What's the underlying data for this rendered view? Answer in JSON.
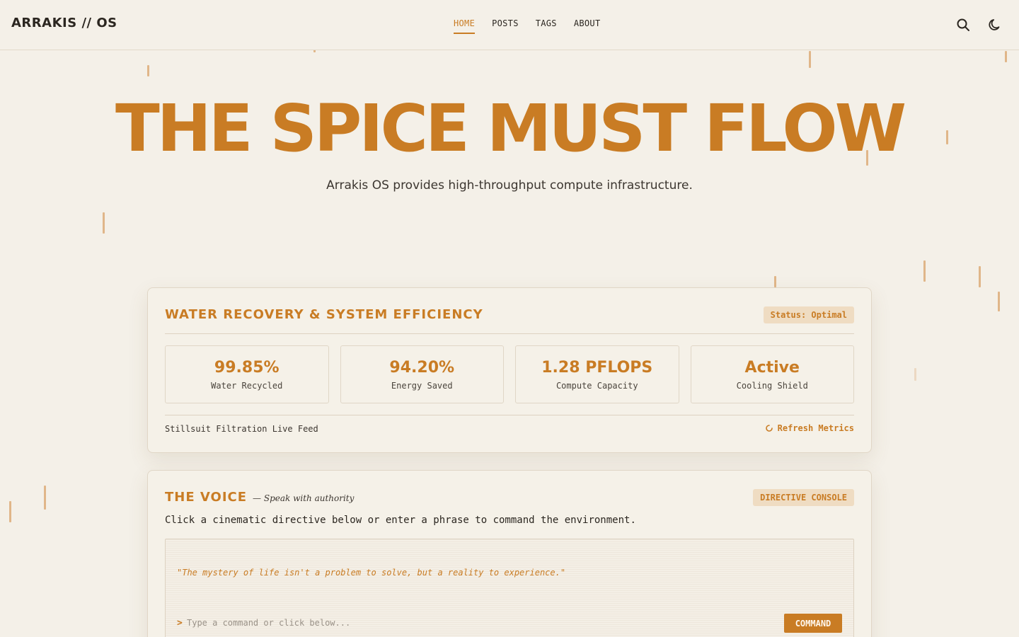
{
  "header": {
    "logo": "ARRAKIS // OS",
    "nav": [
      {
        "label": "HOME",
        "active": true
      },
      {
        "label": "POSTS",
        "active": false
      },
      {
        "label": "TAGS",
        "active": false
      },
      {
        "label": "ABOUT",
        "active": false
      }
    ],
    "icons": {
      "search": "search-icon",
      "theme": "moon-icon"
    }
  },
  "hero": {
    "title": "THE SPICE MUST FLOW",
    "subtitle": "Arrakis OS provides high-throughput compute infrastructure."
  },
  "efficiency": {
    "title": "WATER RECOVERY & SYSTEM EFFICIENCY",
    "status": "Status: Optimal",
    "metrics": [
      {
        "value": "99.85%",
        "label": "Water Recycled"
      },
      {
        "value": "94.20%",
        "label": "Energy Saved"
      },
      {
        "value": "1.28 PFLOPS",
        "label": "Compute Capacity"
      },
      {
        "value": "Active",
        "label": "Cooling Shield"
      }
    ],
    "feed_label": "Stillsuit Filtration Live Feed",
    "refresh_label": "Refresh Metrics"
  },
  "voice": {
    "title": "THE VOICE",
    "tagline": "— Speak with authority",
    "badge": "DIRECTIVE CONSOLE",
    "description": "Click a cinematic directive below or enter a phrase to command the environment.",
    "quote": "\"The mystery of life isn't a problem to solve, but a reality to experience.\"",
    "prompt_symbol": ">",
    "input_placeholder": "Type a command or click below...",
    "command_label": "COMMAND"
  },
  "colors": {
    "accent": "#c97c24",
    "background": "#f4f0e8",
    "badge_bg": "#efdcc2"
  }
}
